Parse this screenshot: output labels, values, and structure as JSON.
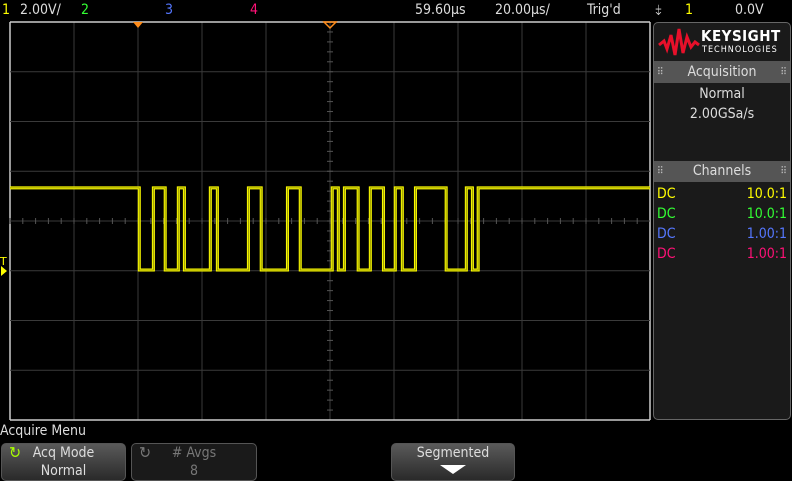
{
  "status_bar": {
    "ch1_label": "1",
    "ch1_scale": "2.00V/",
    "ch2_label": "2",
    "ch3_label": "3",
    "ch4_label": "4",
    "time_delay": "59.60µs",
    "time_scale": "20.00µs/",
    "trigger_status": "Trig'd",
    "trigger_slope_icon": "falling-edge-icon",
    "trigger_source": "1",
    "trigger_level": "0.0V"
  },
  "colors": {
    "ch1": "#ffff00",
    "ch2": "#33ff33",
    "ch3": "#5577ff",
    "ch4": "#ff1177",
    "trigger_marker": "#ff8c1a"
  },
  "side_panel": {
    "brand": "KEYSIGHT",
    "brand_sub": "TECHNOLOGIES",
    "acquisition": {
      "title": "Acquisition",
      "mode": "Normal",
      "sample_rate": "2.00GSa/s"
    },
    "channels": {
      "title": "Channels",
      "rows": [
        {
          "coupling": "DC",
          "probe": "10.0:1"
        },
        {
          "coupling": "DC",
          "probe": "10.0:1"
        },
        {
          "coupling": "DC",
          "probe": "1.00:1"
        },
        {
          "coupling": "DC",
          "probe": "1.00:1"
        }
      ]
    }
  },
  "softkeys": {
    "menu_title": "Acquire Menu",
    "acq_mode_label": "Acq Mode",
    "acq_mode_value": "Normal",
    "avgs_label": "# Avgs",
    "avgs_value": "8",
    "segmented_label": "Segmented"
  },
  "chart_data": {
    "type": "line",
    "channel": "1",
    "units_x": "µs",
    "units_y": "V",
    "time_per_div_us": 20,
    "volts_per_div": 2,
    "center_time_us": 59.6,
    "high_level_v": 3.3,
    "low_level_v": 0,
    "initial_level": "high",
    "edges_us": [
      0,
      4.4,
      8.1,
      12.2,
      14.1,
      22.2,
      24.4,
      34.1,
      38.1,
      46.3,
      50.3,
      60.3,
      62.2,
      64.1,
      68.4,
      72.2,
      76.3,
      80.0,
      82.2,
      86.3,
      95.9,
      102.2,
      104.1,
      105.9
    ]
  }
}
